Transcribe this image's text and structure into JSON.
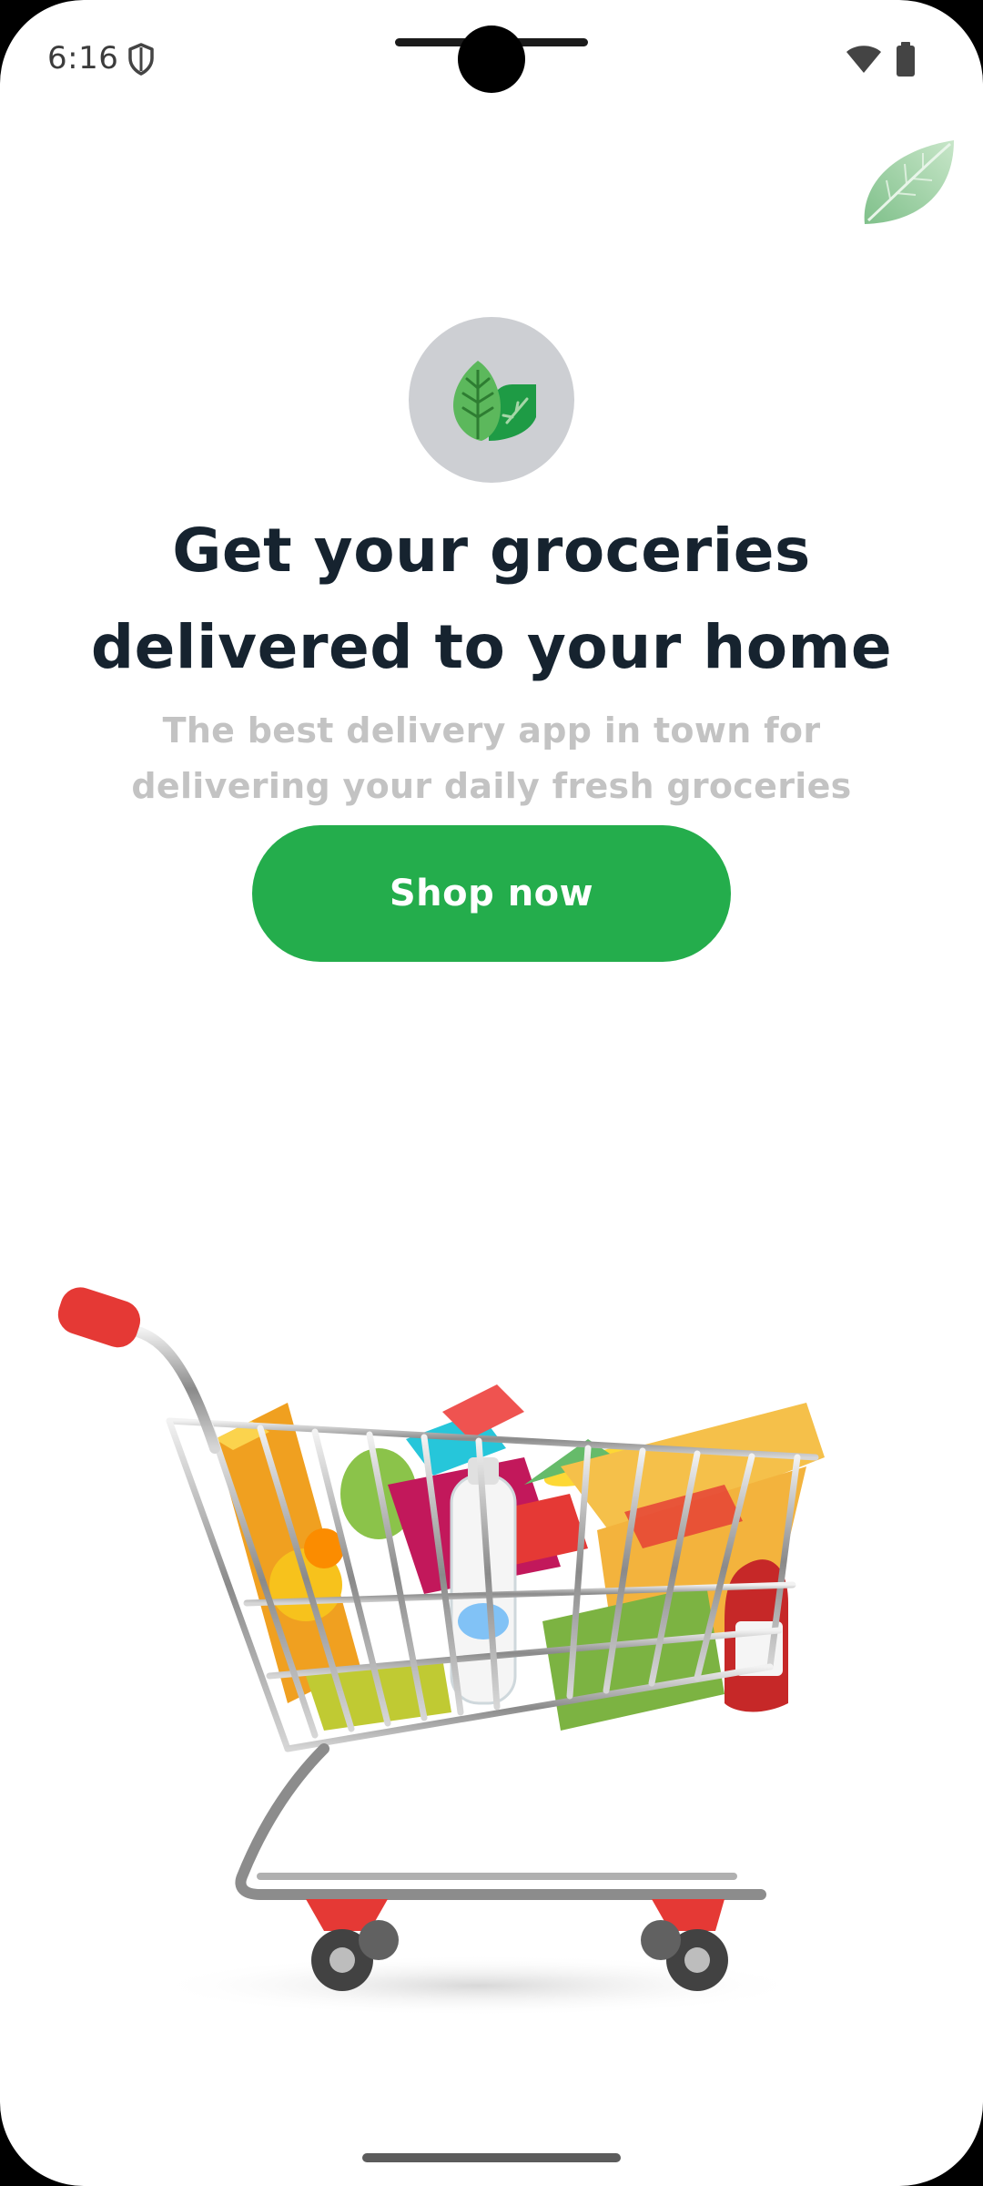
{
  "status_bar": {
    "time": "6:16",
    "icons": [
      "shield-icon",
      "wifi-icon",
      "battery-icon"
    ]
  },
  "hero": {
    "logo_icon": "leaf-logo-icon",
    "headline_line1": "Get your groceries",
    "headline_line2": "delivered to your home",
    "subtitle_line1": "The best delivery app in town for",
    "subtitle_line2": "delivering your daily fresh groceries",
    "cta_label": "Shop now"
  },
  "illustration": {
    "name": "shopping-cart-with-groceries"
  },
  "colors": {
    "accent": "#24ad4c",
    "headline": "#16232f",
    "subtitle": "#c3c3c3",
    "logo_bg": "#cdcfd3"
  }
}
